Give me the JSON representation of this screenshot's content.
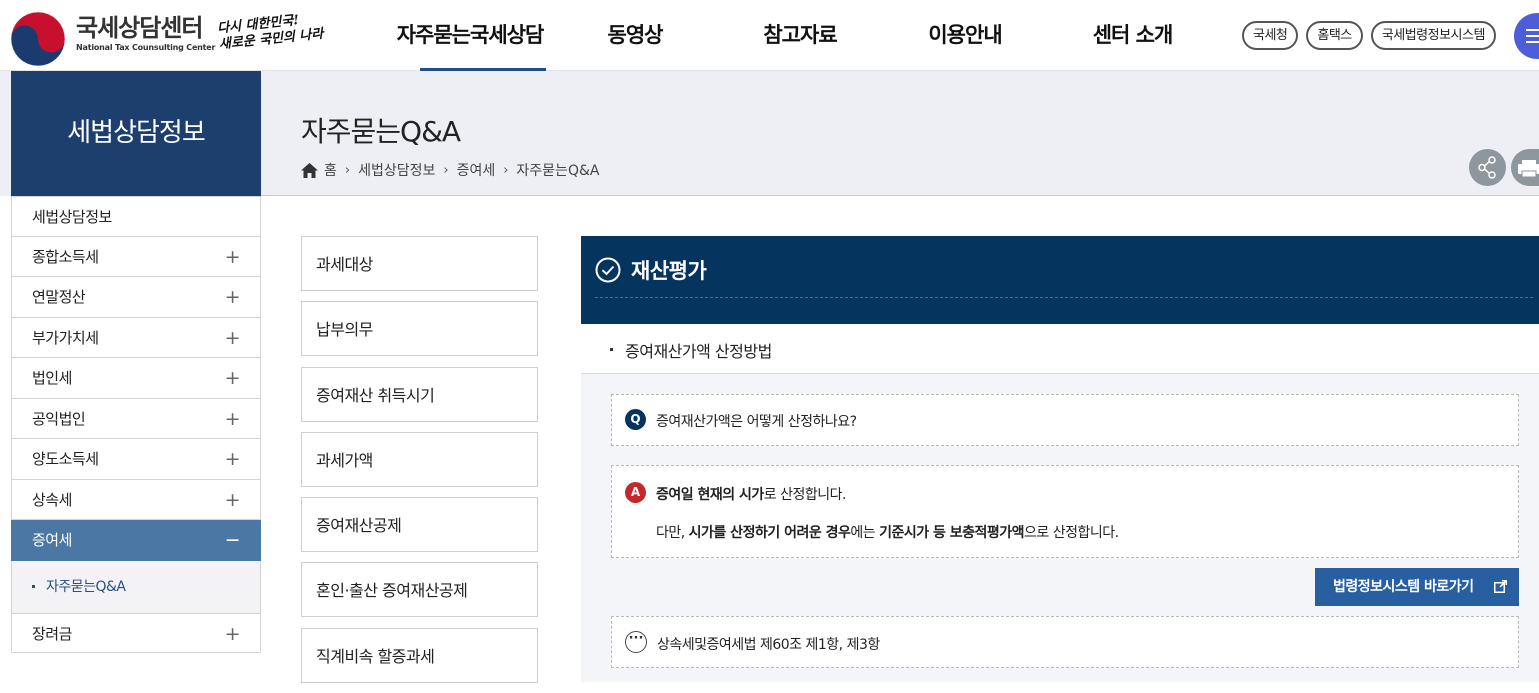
{
  "header": {
    "logo_ko": "국세상담센터",
    "logo_en": "National Tax Counsulting Center",
    "slogan_line1": "다시 대한민국!",
    "slogan_line2": "새로운 국민의 나라",
    "gnb": [
      "자주묻는국세상담",
      "동영상",
      "참고자료",
      "이용안내",
      "센터 소개"
    ],
    "active_gnb": "자주묻는국세상담",
    "util_links": [
      "국세청",
      "홈택스",
      "국세법령정보시스템"
    ],
    "brand_color": "#1c3f6e",
    "menu_color": "#4d5fd8"
  },
  "lnb": {
    "title": "세법상담정보",
    "items": [
      "세법상담정보",
      "종합소득세",
      "연말정산",
      "부가가치세",
      "법인세",
      "공익법인",
      "양도소득세",
      "상속세",
      "증여세",
      "장려금"
    ],
    "active": "증여세",
    "active_color": "#4a77a3",
    "sub_item": "자주묻는Q&A"
  },
  "page": {
    "title": "자주묻는Q&A",
    "breadcrumb": [
      "홈",
      "세법상담정보",
      "증여세",
      "자주묻는Q&A"
    ],
    "share_icon": "share-icon",
    "print_icon": "print-icon"
  },
  "topics": [
    "과세대상",
    "납부의무",
    "증여재산 취득시기",
    "과세가액",
    "증여재산공제",
    "혼인·출산 증여재산공제",
    "직계비속 할증과세"
  ],
  "content": {
    "section_title": "재산평가",
    "header_color": "#05345f",
    "subtitle": "증여재산가액 산정방법",
    "question_badge": "Q",
    "question": "증여재산가액은 어떻게 산정하나요?",
    "answer_badge": "A",
    "answer_line1": {
      "bold1": "증여일 현재의 시가",
      "rest1": "로 산정합니다."
    },
    "answer_line2": {
      "pre": "다만, ",
      "bold1": "시가를 산정하기 어려운 경우",
      "mid": "에는 ",
      "bold2": "기준시가 등 보충적평가액",
      "post": "으로 산정합니다."
    },
    "law_button": "법령정보시스템 바로가기",
    "reference": "상속세및증여세법 제60조 제1항, 제3항"
  }
}
